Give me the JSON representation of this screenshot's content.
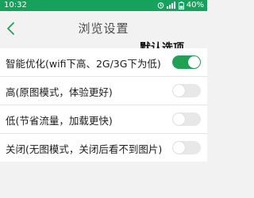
{
  "status_bar": {
    "time": "10:32",
    "battery": "40%"
  },
  "nav": {
    "title": "浏览设置"
  },
  "annotation": "默认选项",
  "accent_color": "#22a156",
  "options": [
    {
      "label": "智能优化(wifi下高、2G/3G下为低)",
      "enabled": true
    },
    {
      "label": "高(原图模式，体验更好)",
      "enabled": false
    },
    {
      "label": "低(节省流量，加载更快)",
      "enabled": false
    },
    {
      "label": "关闭(无图模式，关闭后看不到图片)",
      "enabled": false
    }
  ]
}
